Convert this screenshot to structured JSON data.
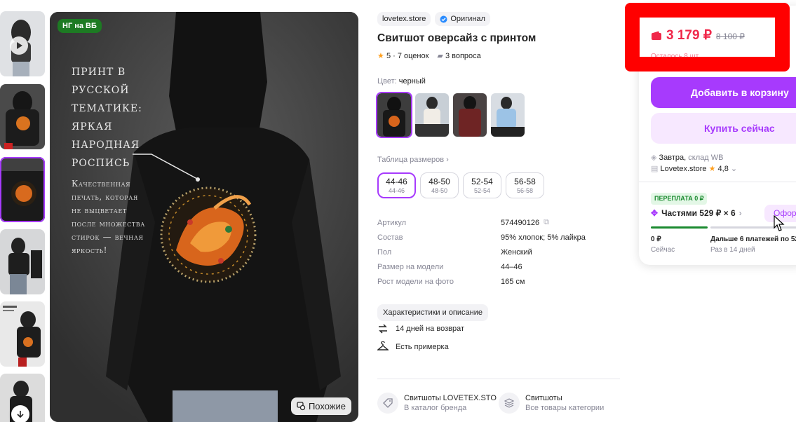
{
  "colors": {
    "accent": "#a73afd",
    "price": "#f0284a",
    "badge_green": "#1d7a23",
    "highlight_box": "#ff0000"
  },
  "gallery": {
    "thumbnails": [
      {
        "name": "thumb-video",
        "has_play": true
      },
      {
        "name": "thumb-back-print"
      },
      {
        "name": "thumb-print-closeup"
      },
      {
        "name": "thumb-front-view"
      },
      {
        "name": "thumb-infographic"
      },
      {
        "name": "thumb-sixth"
      }
    ],
    "active_thumbnail": 3,
    "badge": "НГ на ВБ",
    "promo_heading": "Принт в русской тематике: яркая народная роспись",
    "promo_text": "Качественная печать, которая не выцветает после множества стирок — вечная яркость!",
    "similar_label": "Похожие"
  },
  "product": {
    "seller": "lovetex.store",
    "original_label": "Оригинал",
    "title": "Свитшот оверсайз с принтом",
    "rating": "5 · 7 оценок",
    "questions": "3 вопроса",
    "color_label": "Цвет:",
    "color_value": "черный",
    "size_table_label": "Таблица размеров",
    "sizes": [
      {
        "main": "44-46",
        "sub": "44-46",
        "selected": true
      },
      {
        "main": "48-50",
        "sub": "48-50"
      },
      {
        "main": "52-54",
        "sub": "52-54"
      },
      {
        "main": "56-58",
        "sub": "56-58"
      }
    ],
    "specs": [
      {
        "key": "Артикул",
        "value": "574490126"
      },
      {
        "key": "Состав",
        "value": "95% хлопок; 5% лайкра"
      },
      {
        "key": "Пол",
        "value": "Женский"
      },
      {
        "key": "Размер на модели",
        "value": "44–46"
      },
      {
        "key": "Рост модели на фото",
        "value": "165 см"
      }
    ],
    "characteristics_button": "Характеристики и описание",
    "return_policy": "14 дней на возврат",
    "fitting": "Есть примерка",
    "brand_card": {
      "title": "Свитшоты LOVETEX.STO",
      "subtitle": "В каталог бренда"
    },
    "category_card": {
      "title": "Свитшоты",
      "subtitle": "Все товары категории"
    }
  },
  "purchase": {
    "price_now": "3 179 ₽",
    "price_old": "8 100 ₽",
    "stock_left": "Осталось 8 шт",
    "add_to_cart": "Добавить в корзину",
    "buy_now": "Купить сейчас",
    "delivery_when": "Завтра,",
    "delivery_where": "склад WB",
    "store_name": "Lovetex.store",
    "store_rating": "4,8",
    "overpay_badge": "ПЕРЕПЛАТА 0 ₽",
    "installments": "Частями 529 ₽ × 6",
    "checkout_button": "Офор",
    "pay_now_amount": "0 ₽",
    "pay_now_label": "Сейчас",
    "pay_later_amount": "Дальше 6 платежей по 52",
    "pay_later_label": "Раз в 14 дней"
  }
}
